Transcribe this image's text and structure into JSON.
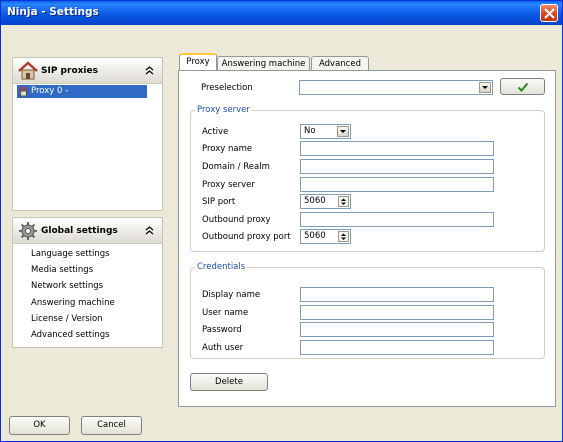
{
  "window": {
    "title": "Ninja - Settings"
  },
  "sip_panel": {
    "title": "SIP proxies",
    "items": [
      {
        "label": "Proxy 0 -"
      }
    ]
  },
  "global_panel": {
    "title": "Global settings",
    "items": [
      {
        "label": "Language settings"
      },
      {
        "label": "Media settings"
      },
      {
        "label": "Network settings"
      },
      {
        "label": "Answering machine"
      },
      {
        "label": "License / Version"
      },
      {
        "label": "Advanced settings"
      }
    ]
  },
  "tabs": [
    {
      "label": "Proxy",
      "active": true
    },
    {
      "label": "Answering machine",
      "active": false
    },
    {
      "label": "Advanced",
      "active": false
    }
  ],
  "preselection": {
    "label": "Preselection",
    "value": ""
  },
  "proxy_server": {
    "legend": "Proxy server",
    "active_label": "Active",
    "active_value": "No",
    "proxy_name_label": "Proxy name",
    "proxy_name_value": "",
    "domain_label": "Domain / Realm",
    "domain_value": "",
    "proxy_server_label": "Proxy server",
    "proxy_server_value": "",
    "sip_port_label": "SIP port",
    "sip_port_value": "5060",
    "outbound_proxy_label": "Outbound proxy",
    "outbound_proxy_value": "",
    "outbound_port_label": "Outbound proxy port",
    "outbound_port_value": "5060"
  },
  "credentials": {
    "legend": "Credentials",
    "display_name_label": "Display name",
    "display_name_value": "",
    "user_name_label": "User name",
    "user_name_value": "",
    "password_label": "Password",
    "password_value": "",
    "auth_user_label": "Auth user",
    "auth_user_value": ""
  },
  "buttons": {
    "delete": "Delete",
    "ok": "OK",
    "cancel": "Cancel"
  },
  "colors": {
    "title_bar": "#0a5fe8",
    "selection": "#316ac5",
    "legend": "#1f4fb0",
    "tab_highlight": "#ffc83c"
  }
}
